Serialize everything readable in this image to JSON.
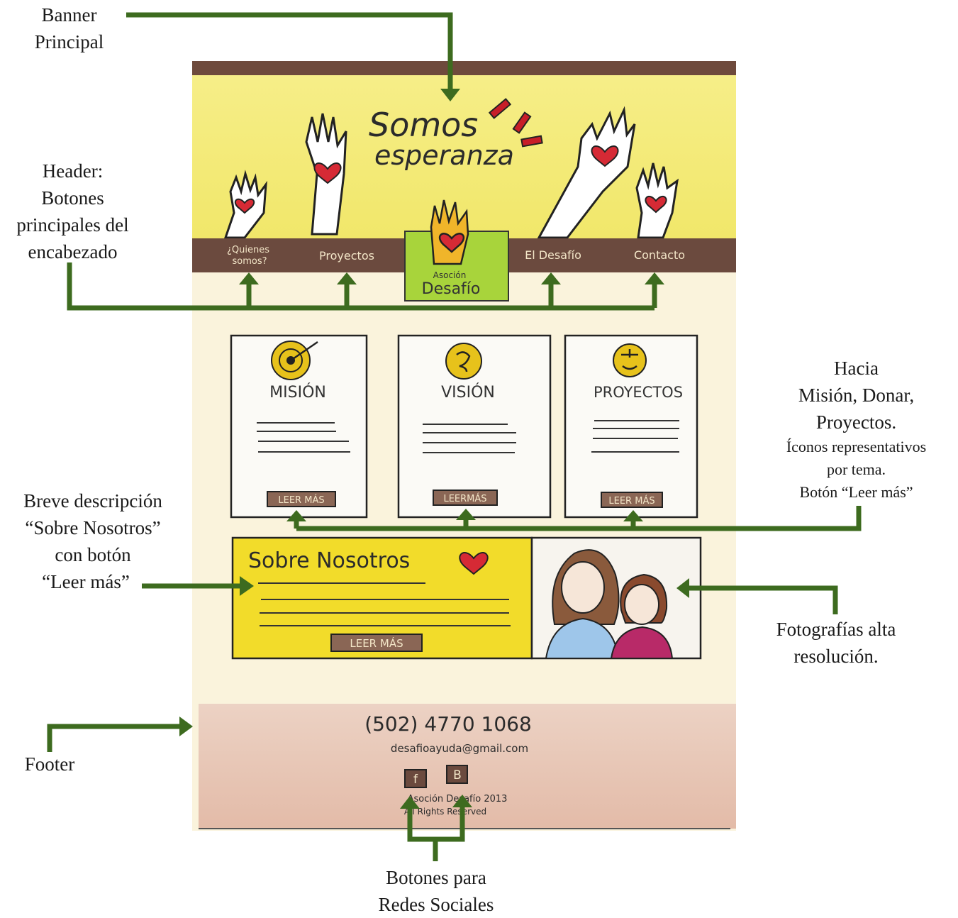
{
  "annotations": {
    "banner": [
      "Banner",
      "Principal"
    ],
    "header": [
      "Header:",
      "Botones",
      "principales del",
      "encabezado"
    ],
    "cards": [
      "Hacia",
      "Misión, Donar,",
      "Proyectos."
    ],
    "cards_small": [
      "Íconos representativos",
      "por tema.",
      "Botón “Leer más”"
    ],
    "about": [
      "Breve descripción",
      "“Sobre Nosotros”",
      "con botón",
      "“Leer más”"
    ],
    "photos": [
      "Fotografías alta",
      "resolución."
    ],
    "footer": [
      "Footer"
    ],
    "social": [
      "Botones para",
      "Redes Sociales"
    ]
  },
  "sketch": {
    "banner_title_1": "Somos",
    "banner_title_2": "esperanza",
    "nav": [
      "¿Quienes somos?",
      "Proyectos",
      "El Desafío",
      "Contacto"
    ],
    "logo_small": "Asoción",
    "logo_big": "Desafío",
    "cards": [
      {
        "title": "MISIÓN",
        "button": "LEER MÁS",
        "icon": "target-icon"
      },
      {
        "title": "VISIÓN",
        "button": "LEERMÁS",
        "icon": "hand-heart-icon"
      },
      {
        "title": "PROYECTOS",
        "button": "LEER MÁS",
        "icon": "hands-icon"
      }
    ],
    "about_title": "Sobre Nosotros",
    "about_button": "LEER MÁS",
    "phone": "(502) 4770 1068",
    "email": "desafioayuda@gmail.com",
    "social": [
      "f",
      "B"
    ],
    "copyright_1": "Asoción Desafío 2013",
    "copyright_2": "All Rights Reserved"
  },
  "colors": {
    "arrow": "#3d6b1f",
    "banner_yellow": "#f3ea7a",
    "nav_brown": "#6b4a3e",
    "logo_green": "#a8d43b",
    "about_yellow": "#f2dc2a",
    "footer_pink": "#e8c6b8"
  }
}
